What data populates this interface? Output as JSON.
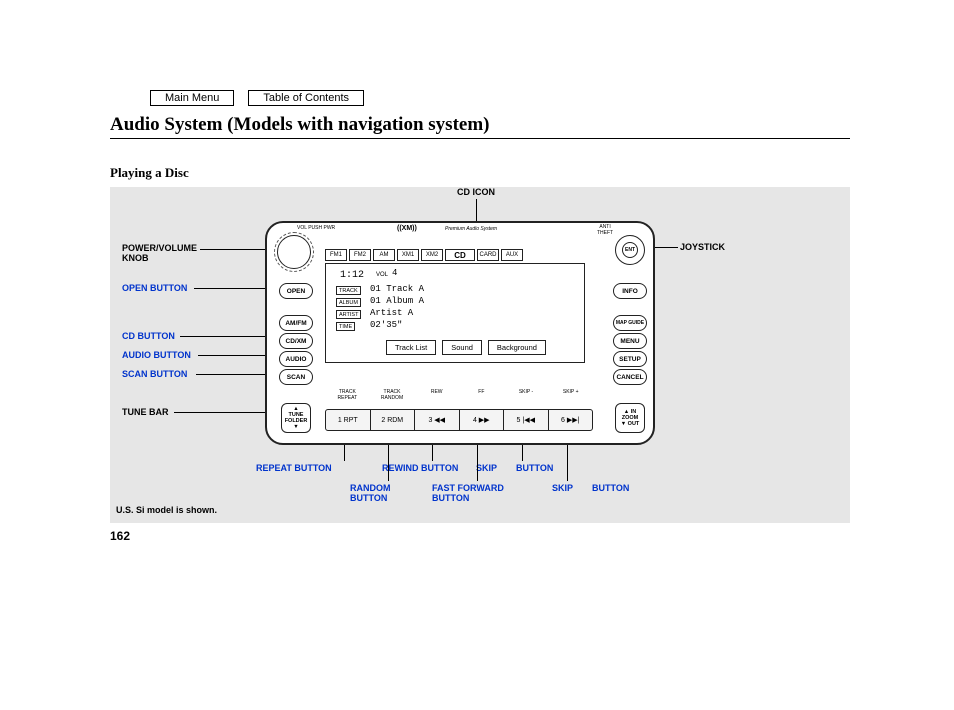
{
  "nav": {
    "main_menu": "Main Menu",
    "toc": "Table of Contents"
  },
  "title": "Audio System (Models with navigation system)",
  "subtitle": "Playing a Disc",
  "callouts": {
    "cd_icon": "CD ICON",
    "power_volume": "POWER/VOLUME\nKNOB",
    "open_button": "OPEN BUTTON",
    "cd_button": "CD BUTTON",
    "audio_button": "AUDIO BUTTON",
    "scan_button": "SCAN BUTTON",
    "tune_bar": "TUNE BAR",
    "joystick": "JOYSTICK",
    "repeat_button": "REPEAT BUTTON",
    "random_button": "RANDOM\nBUTTON",
    "rewind_button": "REWIND BUTTON",
    "fast_forward": "FAST FORWARD\nBUTTON",
    "skip": "SKIP",
    "button": "BUTTON",
    "skip2": "SKIP",
    "button2": "BUTTON"
  },
  "unit": {
    "top_left": "VOL PUSH PWR",
    "brand": "((XM))",
    "subtitle": "Premium Audio System",
    "anti_theft": "ANTI\nTHEFT",
    "tabs": [
      "FM1",
      "FM2",
      "AM",
      "XM1",
      "XM2",
      "CD",
      "CARD",
      "AUX"
    ],
    "left_buttons": {
      "open": "OPEN",
      "amfm": "AM/FM",
      "cdxm": "CD/XM",
      "audio": "AUDIO",
      "scan": "SCAN"
    },
    "tune": {
      "up": "▲",
      "label1": "TUNE",
      "label2": "FOLDER",
      "down": "▼"
    },
    "right_buttons": {
      "ent": "ENT",
      "info": "INFO",
      "map": "MAP GUIDE",
      "menu": "MENU",
      "setup": "SETUP",
      "cancel": "CANCEL"
    },
    "zoom": {
      "in": "▲ IN",
      "label": "ZOOM",
      "out": "▼ OUT"
    },
    "display": {
      "time": "1:12",
      "vol_label": "VOL",
      "vol_value": "4",
      "rows": {
        "track_lbl": "TRACK",
        "track_val": "01 Track A",
        "album_lbl": "ALBUM",
        "album_val": "01 Album A",
        "artist_lbl": "ARTIST",
        "artist_val": "Artist A",
        "time_lbl": "TIME",
        "time_val": "02'35\""
      },
      "soft": [
        "Track  List",
        "Sound",
        "Background"
      ]
    },
    "bottom_labels": [
      "TRACK\nREPEAT",
      "TRACK\nRANDOM",
      "REW",
      "FF",
      "SKIP -",
      "SKIP +"
    ],
    "bottom_keys": [
      "1 RPT",
      "2 RDM",
      "3 ◀◀",
      "4 ▶▶",
      "5 |◀◀",
      "6 ▶▶|"
    ]
  },
  "footnote": "U.S. Si model is shown.",
  "page_number": "162"
}
